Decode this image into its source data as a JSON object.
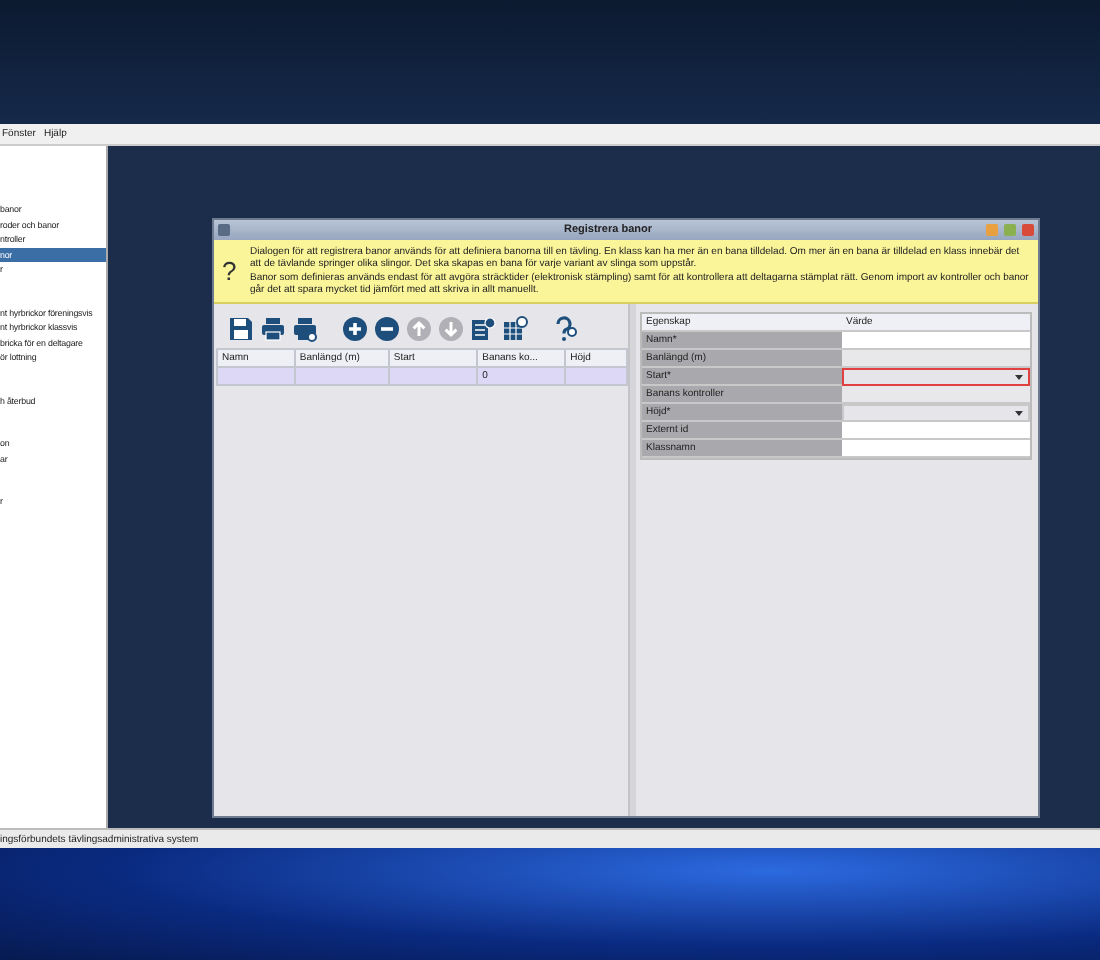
{
  "menu_bar": {
    "items": [
      "Fönster",
      "Hjälp"
    ]
  },
  "sidebar": {
    "groups": [
      {
        "items": [
          {
            "label": "banor",
            "selected": false
          },
          {
            "label": "roder och banor",
            "selected": false
          },
          {
            "label": "ntroller",
            "selected": false
          },
          {
            "label": "nor",
            "selected": true
          },
          {
            "label": "r",
            "selected": false
          }
        ]
      },
      {
        "items": [
          {
            "label": "nt hyrbrickor föreningsvis",
            "selected": false
          },
          {
            "label": "nt hyrbrickor klassvis",
            "selected": false
          },
          {
            "label": "bricka för en deltagare",
            "selected": false
          },
          {
            "label": "ör lottning",
            "selected": false
          }
        ]
      },
      {
        "items": [
          {
            "label": "h återbud",
            "selected": false
          }
        ]
      },
      {
        "items": [
          {
            "label": "on",
            "selected": false
          },
          {
            "label": "ar",
            "selected": false
          }
        ]
      },
      {
        "items": [
          {
            "label": "r",
            "selected": false
          }
        ]
      }
    ]
  },
  "status_bar": "ingsförbundets tävlingsadministrativa system",
  "dialog": {
    "title": "Registrera banor",
    "info": [
      "Dialogen för att registrera banor används för att definiera banorna till en tävling. En klass kan ha mer än en bana tilldelad. Om mer än en bana är tilldelad en klass innebär det att de tävlande springer olika slingor. Det ska skapas en bana för varje variant av slinga som uppstår.",
      "Banor som definieras används endast för att avgöra sträcktider (elektronisk stämpling) samt för att kontrollera att deltagarna stämplat rätt. Genom import av kontroller och banor går det att spara mycket tid jämfört med att skriva in allt manuellt."
    ],
    "info_icon": "?",
    "toolbar": [
      {
        "kind": "save",
        "disabled": false
      },
      {
        "kind": "print",
        "disabled": false
      },
      {
        "kind": "print-preview",
        "disabled": false
      },
      {
        "kind": "add",
        "disabled": false
      },
      {
        "kind": "remove",
        "disabled": false
      },
      {
        "kind": "up",
        "disabled": true
      },
      {
        "kind": "down",
        "disabled": true
      },
      {
        "kind": "edit",
        "disabled": false
      },
      {
        "kind": "table",
        "disabled": false
      },
      {
        "kind": "help",
        "disabled": false
      }
    ],
    "table": {
      "columns": [
        "Namn",
        "Banlängd (m)",
        "Start",
        "Banans ko...",
        "Höjd"
      ],
      "rows": [
        {
          "cells": [
            "",
            "",
            "",
            "0",
            ""
          ],
          "selected": true
        }
      ]
    },
    "properties": {
      "columns": [
        "Egenskap",
        "Värde"
      ],
      "rows": [
        {
          "label": "Namn*",
          "kind": "text",
          "error": false
        },
        {
          "label": "Banlängd (m)",
          "kind": "readonly",
          "error": false
        },
        {
          "label": "Start*",
          "kind": "dropdown",
          "error": true
        },
        {
          "label": "Banans kontroller",
          "kind": "readonly",
          "error": false
        },
        {
          "label": "Höjd*",
          "kind": "dropdown",
          "error": false
        },
        {
          "label": "Externt id",
          "kind": "text",
          "error": false
        },
        {
          "label": "Klassnamn",
          "kind": "text",
          "error": false
        }
      ]
    }
  }
}
